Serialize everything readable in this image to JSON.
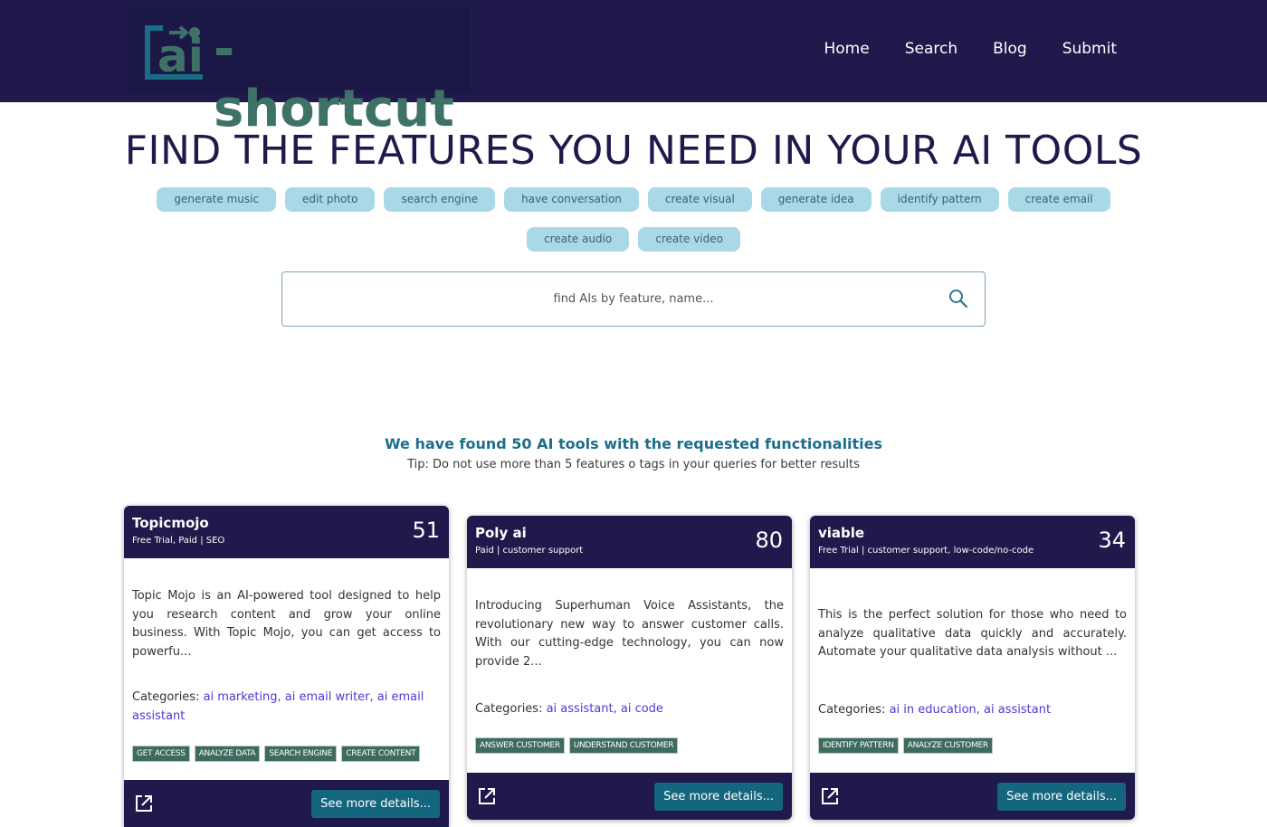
{
  "logo": {
    "text": "-shortcut",
    "mark_letters": "ai"
  },
  "nav": [
    {
      "label": "Home"
    },
    {
      "label": "Search"
    },
    {
      "label": "Blog"
    },
    {
      "label": "Submit"
    }
  ],
  "hero": {
    "title": "FIND THE FEATURES YOU NEED IN YOUR AI TOOLS",
    "tags_row1": [
      "generate music",
      "edit photo",
      "search engine",
      "have conversation",
      "create visual",
      "generate idea",
      "identify pattern",
      "create email"
    ],
    "tags_row2": [
      "create audio",
      "create video"
    ]
  },
  "search": {
    "placeholder": "find AIs by feature, name..."
  },
  "results": {
    "found_text": "We have found 50 AI tools with the requested functionalities",
    "tip_text": "Tip: Do not use more than 5 features o tags in your queries for better results"
  },
  "cards": [
    {
      "name": "Topicmojo",
      "meta": "Free Trial, Paid | SEO",
      "score": "51",
      "description": "Topic Mojo is an AI-powered tool designed to help you research content and grow your online business. With Topic Mojo, you can get access to powerfu...",
      "categories_label": "Categories:",
      "categories": "ai marketing, ai email writer, ai email assistant",
      "badges": [
        "GET ACCESS",
        "ANALYZE DATA",
        "SEARCH ENGINE",
        "CREATE CONTENT"
      ],
      "button": "See more details..."
    },
    {
      "name": "Poly ai",
      "meta": "Paid | customer support",
      "score": "80",
      "description": "Introducing Superhuman Voice Assistants, the revolutionary new way to answer customer calls. With our cutting-edge technology, you can now provide 2...",
      "categories_label": "Categories:",
      "categories": "ai assistant, ai code",
      "badges": [
        "ANSWER CUSTOMER",
        "UNDERSTAND CUSTOMER"
      ],
      "button": "See more details..."
    },
    {
      "name": "viable",
      "meta": "Free Trial | customer support, low-code/no-code",
      "score": "34",
      "description": "This is the perfect solution for those who need to analyze qualitative data quickly and accurately. Automate your qualitative data analysis without ...",
      "categories_label": "Categories:",
      "categories": "ai in education, ai assistant",
      "badges": [
        "IDENTIFY PATTERN",
        "ANALYZE CUSTOMER"
      ],
      "button": "See more details..."
    }
  ],
  "colors": {
    "header_bg": "#1f1a4b",
    "logo_green": "#3f7266",
    "tag_bg": "#a9d9e6",
    "badge_bg": "#3d6b5f",
    "button_bg": "#14667e",
    "found_text": "#1d6e8a",
    "category_link": "#4b3bd6"
  }
}
